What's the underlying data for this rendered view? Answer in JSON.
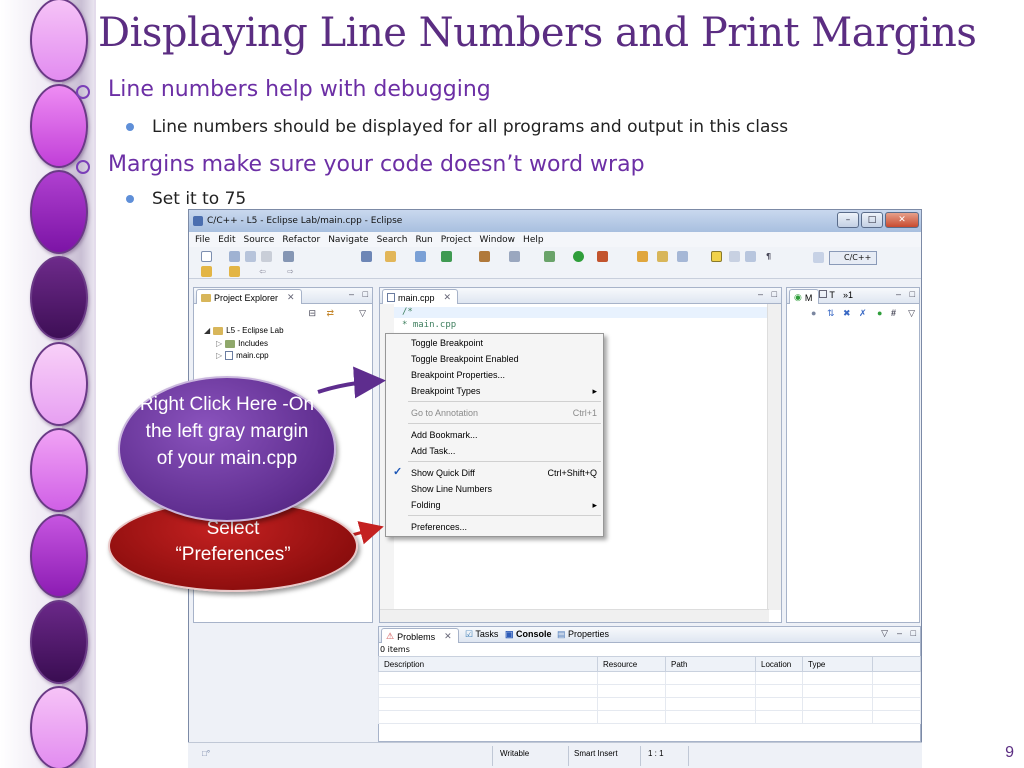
{
  "slide": {
    "title": "Displaying Line Numbers and Print Margins",
    "bullets": [
      {
        "text": "Line numbers help with debugging",
        "sub": [
          "Line numbers should be displayed for all programs and output in this class"
        ]
      },
      {
        "text": "Margins make sure your code doesn’t word wrap",
        "sub": [
          "Set it to 75"
        ]
      }
    ],
    "page_number": "9",
    "accent_color": "#5b2d82"
  },
  "window": {
    "title": "C/C++ - L5 - Eclipse Lab/main.cpp - Eclipse",
    "menu": [
      "File",
      "Edit",
      "Source",
      "Refactor",
      "Navigate",
      "Search",
      "Run",
      "Project",
      "Window",
      "Help"
    ],
    "perspective": "C/C++"
  },
  "project_explorer": {
    "tab": "Project Explorer",
    "tree": [
      "L5 - Eclipse Lab",
      "Includes",
      "main.cpp"
    ]
  },
  "editor": {
    "tab": "main.cpp",
    "lines": [
      "/*",
      " * main.cpp"
    ]
  },
  "outline": {
    "tab_m": "M",
    "tab_t": "T",
    "overflow": "»1"
  },
  "context_menu": {
    "items": [
      {
        "label": "Toggle Breakpoint"
      },
      {
        "label": "Toggle Breakpoint Enabled"
      },
      {
        "label": "Breakpoint Properties..."
      },
      {
        "label": "Breakpoint Types",
        "submenu": true
      },
      {
        "label": "Go to Annotation",
        "shortcut": "Ctrl+1",
        "disabled": true
      },
      {
        "label": "Add Bookmark..."
      },
      {
        "label": "Add Task..."
      },
      {
        "label": "Show Quick Diff",
        "shortcut": "Ctrl+Shift+Q",
        "checked": true
      },
      {
        "label": "Show Line Numbers"
      },
      {
        "label": "Folding",
        "submenu": true
      },
      {
        "label": "Preferences..."
      }
    ]
  },
  "bottom_panel": {
    "tabs": [
      "Problems",
      "Tasks",
      "Console",
      "Properties"
    ],
    "item_count": "0 items",
    "columns": [
      "Description",
      "Resource",
      "Path",
      "Location",
      "Type"
    ]
  },
  "status_bar": {
    "mode": "Writable",
    "insert": "Smart Insert",
    "position": "1 : 1"
  },
  "callouts": {
    "right_click": "Right Click Here -On the left gray margin of your main.cpp",
    "select": "Select “Preferences”"
  }
}
